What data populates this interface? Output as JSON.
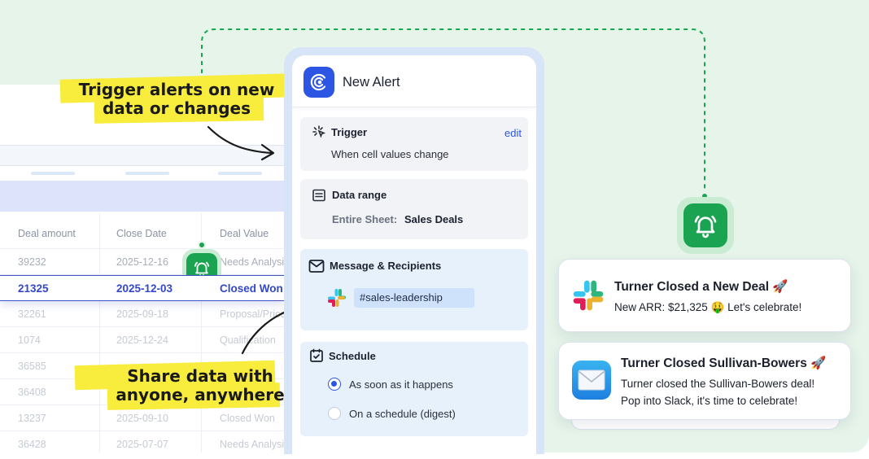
{
  "spreadsheet": {
    "columns": [
      "Deal amount",
      "Close Date",
      "Deal Value"
    ],
    "rows": [
      {
        "amount": "39232",
        "date": "2025-12-16",
        "value": "Needs Analysis"
      },
      {
        "amount": "21325",
        "date": "2025-12-03",
        "value": "Closed Won"
      },
      {
        "amount": "32261",
        "date": "2025-09-18",
        "value": "Proposal/Price"
      },
      {
        "amount": "1074",
        "date": "2025-12-24",
        "value": "Qualification"
      },
      {
        "amount": "36585",
        "date": "",
        "value": "Negotiation"
      },
      {
        "amount": "36408",
        "date": "",
        "value": ""
      },
      {
        "amount": "13237",
        "date": "2025-09-10",
        "value": "Closed Won"
      },
      {
        "amount": "36428",
        "date": "2025-07-07",
        "value": "Needs Analysis"
      }
    ]
  },
  "callouts": {
    "trigger_line1": "Trigger alerts on new",
    "trigger_line2": "data or changes",
    "share_line1": "Share data with",
    "share_line2": "anyone, anywhere"
  },
  "alert_panel": {
    "title": "New Alert",
    "trigger": {
      "label": "Trigger",
      "edit": "edit",
      "value": "When cell values change"
    },
    "data_range": {
      "label": "Data range",
      "key": "Entire Sheet:",
      "value": "Sales Deals"
    },
    "message": {
      "label": "Message & Recipients",
      "channel": "#sales-leadership"
    },
    "schedule": {
      "label": "Schedule",
      "option1": "As soon as it happens",
      "option2": "On a schedule (digest)",
      "selected": "As soon as it happens"
    }
  },
  "notifications": [
    {
      "title": "Turner Closed a New Deal 🚀",
      "line1": "New ARR: $21,325 🤑 Let's celebrate!",
      "icon": "slack-logo"
    },
    {
      "title": "Turner Closed Sullivan-Bowers 🚀",
      "line1": "Turner closed the Sullivan-Bowers deal!",
      "line2": "Pop into Slack, it's time to celebrate!",
      "icon": "mail-icon"
    }
  ],
  "colors": {
    "accent": "#2d55e4",
    "bell_green": "#1aa351",
    "background": "#e6f4ea",
    "highlighter": "#f8ec3c",
    "highlight_row": "#3348c8"
  }
}
